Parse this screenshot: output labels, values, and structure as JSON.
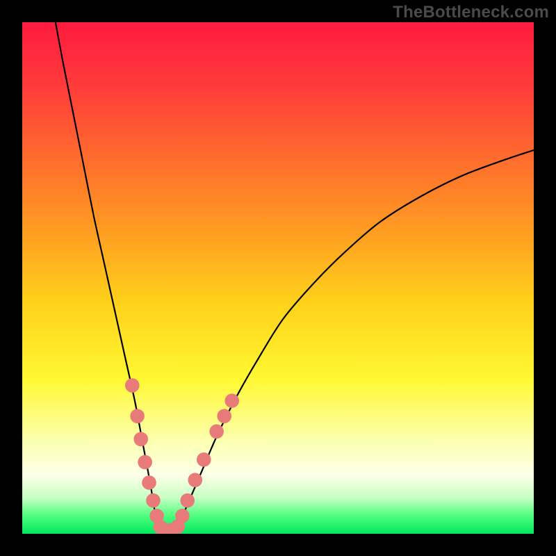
{
  "watermark": "TheBottleneck.com",
  "gradient": {
    "stops": [
      {
        "offset": 0.0,
        "color": "#ff1a3f"
      },
      {
        "offset": 0.12,
        "color": "#ff3a3a"
      },
      {
        "offset": 0.26,
        "color": "#ff6a2e"
      },
      {
        "offset": 0.4,
        "color": "#ff9a22"
      },
      {
        "offset": 0.55,
        "color": "#ffd21a"
      },
      {
        "offset": 0.7,
        "color": "#fff833"
      },
      {
        "offset": 0.82,
        "color": "#fbffb0"
      },
      {
        "offset": 0.885,
        "color": "#fdffe8"
      },
      {
        "offset": 0.93,
        "color": "#c7ffc4"
      },
      {
        "offset": 0.965,
        "color": "#4eff7d"
      },
      {
        "offset": 1.0,
        "color": "#00e85f"
      }
    ]
  },
  "chart_data": {
    "type": "line",
    "title": "",
    "xlabel": "",
    "ylabel": "",
    "xlim": [
      0,
      100
    ],
    "ylim": [
      0,
      100
    ],
    "valley_x": 27,
    "series": [
      {
        "name": "left-curve",
        "x": [
          6.5,
          8,
          10,
          12,
          14,
          16,
          18,
          20,
          22,
          23.5,
          25,
          26,
          27
        ],
        "y": [
          100,
          92,
          82,
          72,
          62,
          53,
          44,
          35,
          26,
          18,
          10,
          4,
          0.5
        ]
      },
      {
        "name": "valley-floor",
        "x": [
          27,
          28.5,
          30
        ],
        "y": [
          0.5,
          0.3,
          0.5
        ]
      },
      {
        "name": "right-curve",
        "x": [
          30,
          32,
          35,
          38,
          42,
          46,
          51,
          57,
          63,
          70,
          78,
          86,
          94,
          100
        ],
        "y": [
          0.5,
          5,
          12,
          19,
          27,
          34,
          42,
          49,
          55,
          61,
          66,
          70,
          73,
          75
        ]
      }
    ],
    "markers": {
      "name": "highlight-dots",
      "color": "#e97a7a",
      "radius_pct": 1.4,
      "points": [
        {
          "x": 21.5,
          "y": 29
        },
        {
          "x": 22.5,
          "y": 23
        },
        {
          "x": 23.2,
          "y": 18.5
        },
        {
          "x": 24.0,
          "y": 14
        },
        {
          "x": 24.8,
          "y": 10
        },
        {
          "x": 25.6,
          "y": 6.5
        },
        {
          "x": 26.3,
          "y": 3.5
        },
        {
          "x": 27.0,
          "y": 1.3
        },
        {
          "x": 28.0,
          "y": 0.7
        },
        {
          "x": 29.2,
          "y": 0.7
        },
        {
          "x": 30.4,
          "y": 1.4
        },
        {
          "x": 31.3,
          "y": 3.5
        },
        {
          "x": 32.3,
          "y": 6.5
        },
        {
          "x": 33.8,
          "y": 10.5
        },
        {
          "x": 35.5,
          "y": 14.5
        },
        {
          "x": 38.0,
          "y": 20
        },
        {
          "x": 39.5,
          "y": 23
        },
        {
          "x": 41.0,
          "y": 26
        }
      ]
    }
  }
}
